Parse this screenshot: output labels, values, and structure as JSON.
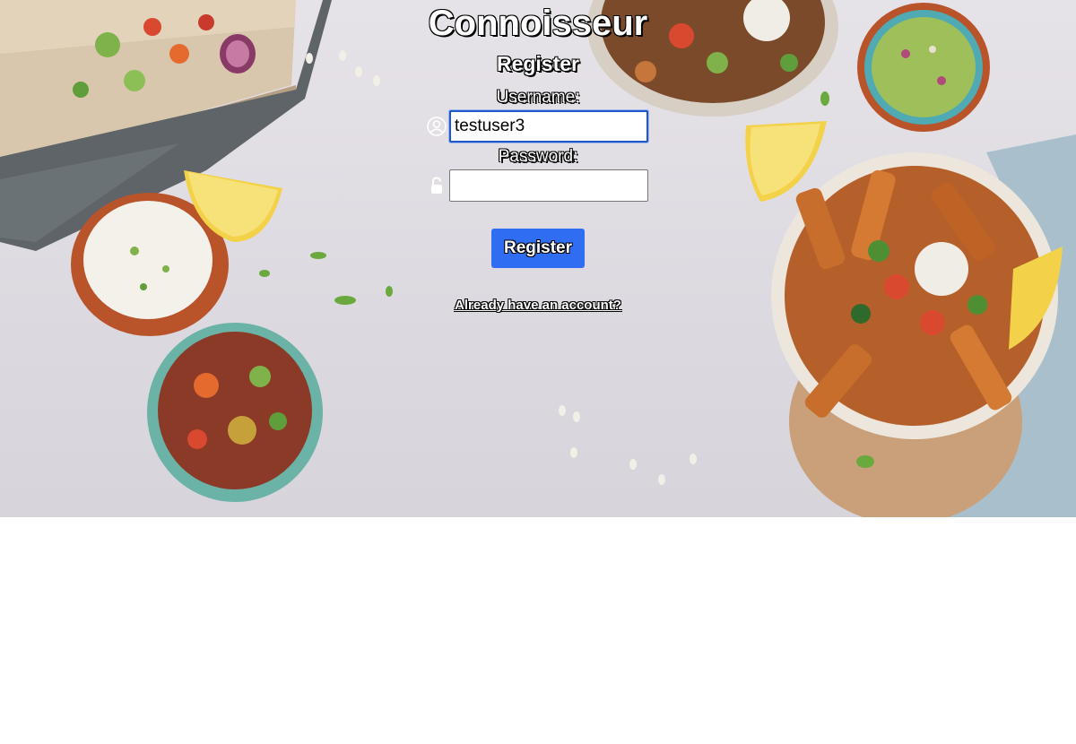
{
  "app": {
    "title": "Connoisseur"
  },
  "form": {
    "heading": "Register",
    "username": {
      "label": "Username:",
      "value": "testuser3",
      "icon": "user-icon"
    },
    "password": {
      "label": "Password:",
      "value": "",
      "icon": "lock-icon"
    },
    "submit_label": "Register",
    "login_link": "Already have an account?"
  },
  "colors": {
    "button": "#2f6ef2",
    "focus_border": "#1f58c9",
    "text": "#ffffff"
  }
}
